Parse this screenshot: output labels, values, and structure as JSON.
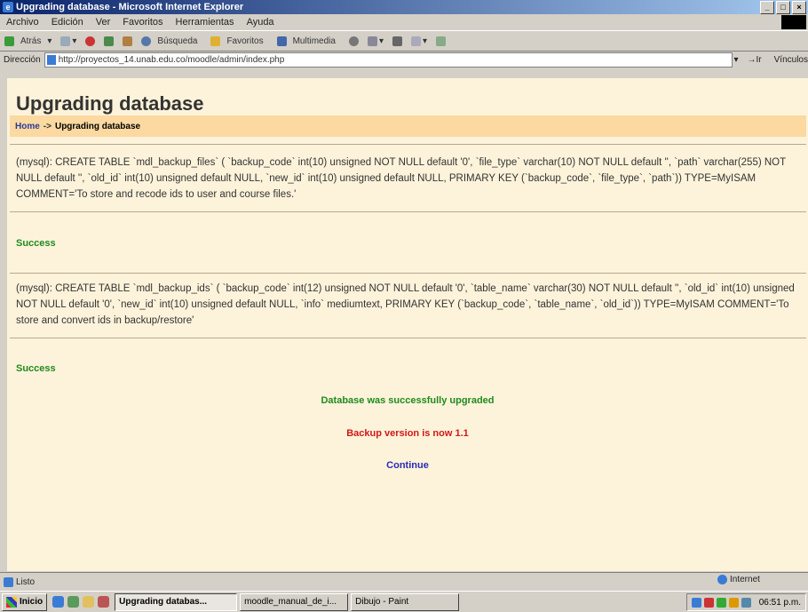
{
  "window": {
    "title": "Upgrading database - Microsoft Internet Explorer"
  },
  "menu": [
    "Archivo",
    "Edición",
    "Ver",
    "Favoritos",
    "Herramientas",
    "Ayuda"
  ],
  "toolbar": {
    "back": "Atrás",
    "search": "Búsqueda",
    "favorites": "Favoritos",
    "multimedia": "Multimedia"
  },
  "address": {
    "label": "Dirección",
    "url": "http://proyectos_14.unab.edu.co/moodle/admin/index.php",
    "go": "Ir",
    "links": "Vínculos"
  },
  "page": {
    "title": "Upgrading database",
    "breadcrumb": {
      "home": "Home",
      "separator": "->",
      "current": "Upgrading database"
    },
    "sql1": "(mysql): CREATE TABLE `mdl_backup_files` ( `backup_code` int(10) unsigned NOT NULL default '0', `file_type` varchar(10) NOT NULL default '', `path` varchar(255) NOT NULL default '', `old_id` int(10) unsigned default NULL, `new_id` int(10) unsigned default NULL, PRIMARY KEY (`backup_code`, `file_type`, `path`)) TYPE=MyISAM COMMENT='To store and recode ids to user and course files.'",
    "success1": "Success",
    "sql2": "(mysql): CREATE TABLE `mdl_backup_ids` ( `backup_code` int(12) unsigned NOT NULL default '0', `table_name` varchar(30) NOT NULL default '', `old_id` int(10) unsigned NOT NULL default '0', `new_id` int(10) unsigned default NULL, `info` mediumtext, PRIMARY KEY (`backup_code`, `table_name`, `old_id`)) TYPE=MyISAM COMMENT='To store and convert ids in backup/restore'",
    "success2": "Success",
    "upgraded": "Database was successfully upgraded",
    "version": "Backup version is now 1.1",
    "continue": "Continue"
  },
  "status": {
    "text": "Listo",
    "zone": "Internet"
  },
  "taskbar": {
    "start": "Inicio",
    "tasks": [
      "Upgrading databas...",
      "moodle_manual_de_i...",
      "Dibujo - Paint"
    ],
    "clock": "06:51 p.m."
  },
  "colors": {
    "page_bg": "#fdf3da",
    "nav_bg": "#fbd9a0",
    "success": "#1f8a1f",
    "version": "#d01818",
    "link": "#2a2ab8"
  }
}
